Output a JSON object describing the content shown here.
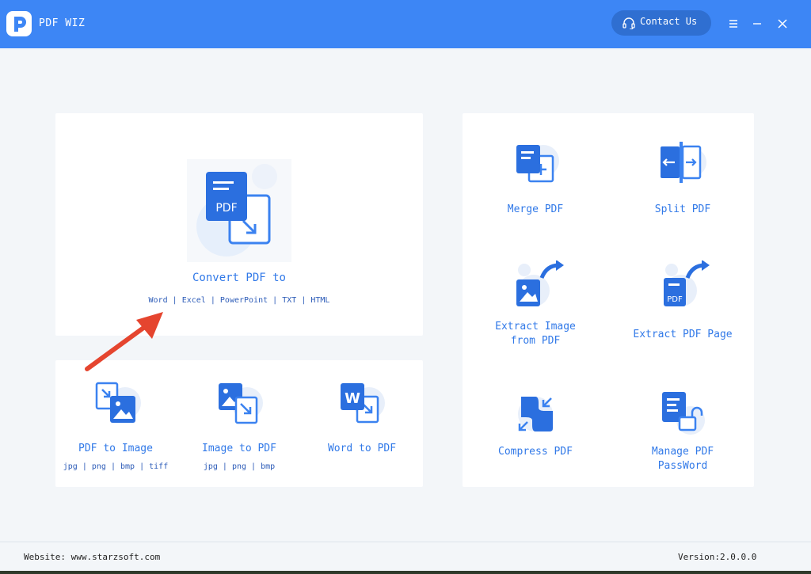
{
  "window": {
    "title": "PDF WIZ",
    "contact_label": "Contact Us",
    "accent_color": "#3d86f5"
  },
  "convert": {
    "label": "Convert PDF to",
    "formats": [
      "Word",
      "Excel",
      "PowerPoint",
      "TXT",
      "HTML"
    ],
    "separator": "|"
  },
  "bottom_tiles": [
    {
      "label": "PDF to Image",
      "sub": "jpg | png | bmp | tiff"
    },
    {
      "label": "Image to PDF",
      "sub": "jpg | png | bmp"
    },
    {
      "label": "Word to PDF",
      "sub": ""
    }
  ],
  "right_tiles": [
    {
      "label": "Merge PDF"
    },
    {
      "label": "Split PDF"
    },
    {
      "label_lines": [
        "Extract Image",
        "from PDF"
      ]
    },
    {
      "label": "Extract PDF Page"
    },
    {
      "label": "Compress PDF"
    },
    {
      "label_lines": [
        "Manage PDF",
        "PassWord"
      ]
    }
  ],
  "icons": {
    "logo": "app-logo",
    "contact": "headset-icon",
    "menu": "menu-icon",
    "minimize": "minimize-icon",
    "close": "close-icon",
    "annotation": "red-arrow-annotation"
  },
  "footer": {
    "website": "Website: www.starzsoft.com",
    "version": "Version:2.0.0.0"
  }
}
